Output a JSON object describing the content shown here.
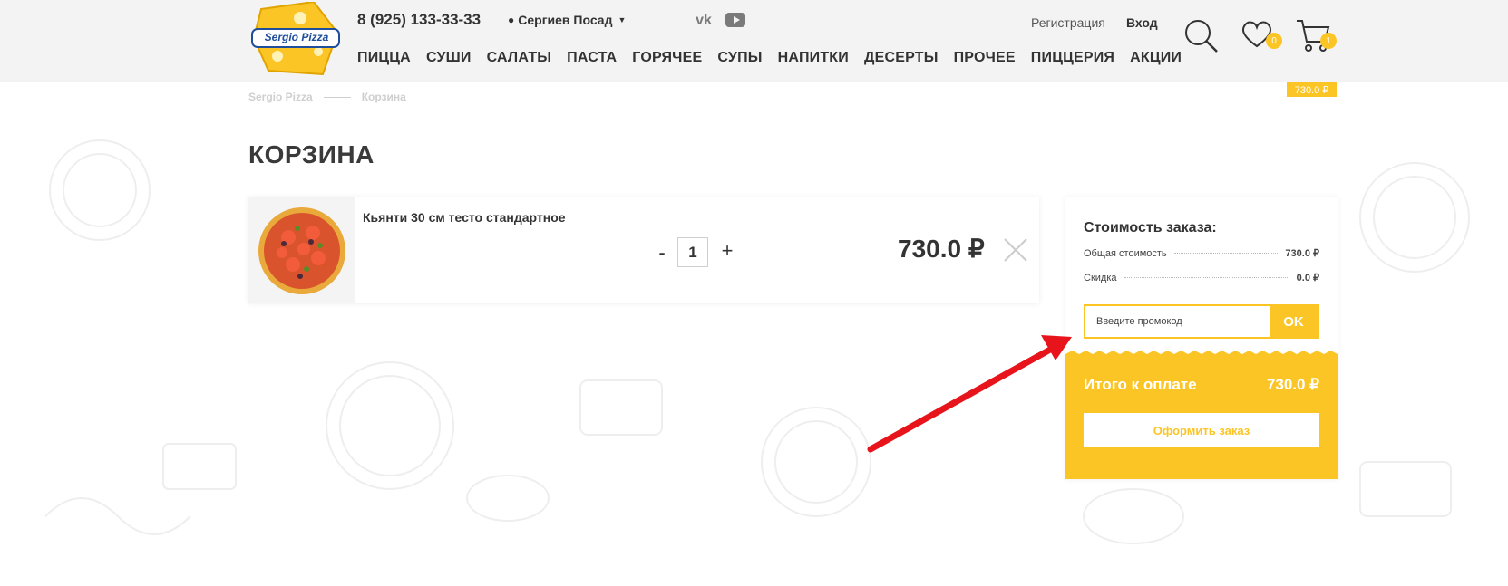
{
  "header": {
    "logo_text": "Sergio Pizza",
    "phone": "8 (925) 133-33-33",
    "city": "Сергиев Посад",
    "social": [
      "vk-icon",
      "youtube-icon"
    ],
    "nav": [
      "ПИЦЦА",
      "СУШИ",
      "САЛАТЫ",
      "ПАСТА",
      "ГОРЯЧЕЕ",
      "СУПЫ",
      "НАПИТКИ",
      "ДЕСЕРТЫ",
      "ПРОЧЕЕ",
      "ПИЦЦЕРИЯ",
      "АКЦИИ"
    ],
    "register": "Регистрация",
    "login": "Вход",
    "favorites_count": "0",
    "cart_count": "1"
  },
  "breadcrumb": {
    "home": "Sergio Pizza",
    "current": "Корзина"
  },
  "mini_total": "730.0 ₽",
  "page_title": "КОРЗИНА",
  "cart": {
    "items": [
      {
        "name": "Кьянти 30 см тесто стандартное",
        "qty": "1",
        "price": "730.0 ₽",
        "minus": "-",
        "plus": "+"
      }
    ]
  },
  "summary": {
    "title": "Стоимость заказа:",
    "total_label": "Общая стоимость",
    "total_value": "730.0 ₽",
    "discount_label": "Скидка",
    "discount_value": "0.0 ₽",
    "promo_placeholder": "Введите промокод",
    "promo_button": "OK",
    "pay_label": "Итого к оплате",
    "pay_value": "730.0 ₽",
    "checkout_button": "Оформить заказ"
  },
  "colors": {
    "accent": "#fbc526",
    "arrow": "#e8141b"
  }
}
